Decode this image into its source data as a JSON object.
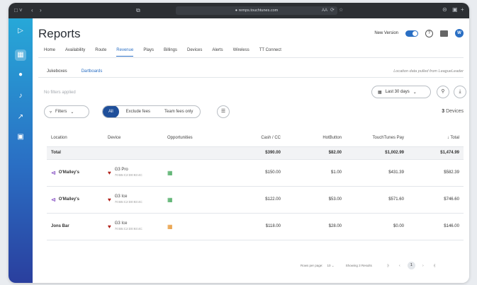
{
  "browser": {
    "url": "● remps.touchtunes.com",
    "tab_controls": "□ ˅",
    "nav_back": "‹",
    "nav_fwd": "›",
    "share": "⧉",
    "reader": "AA",
    "refresh": "⟳",
    "star": "☆"
  },
  "header": {
    "title": "Reports",
    "new_version_label": "New Version",
    "help": "?",
    "avatar": "W"
  },
  "tabs": [
    "Home",
    "Availability",
    "Route",
    "Revenue",
    "Plays",
    "Billings",
    "Devices",
    "Alerts",
    "Wireless",
    "TT Connect"
  ],
  "active_tab": "Revenue",
  "subtabs": [
    "Jukeboxes",
    "Dartboards"
  ],
  "active_subtab": "Dartboards",
  "location_note": "Location data pulled from LeagueLeader",
  "filters": {
    "no_filters": "No filters applied",
    "date_range": "Last 30 days",
    "filters_label": "Filters",
    "segments": [
      "All",
      "Exclude fees",
      "Team fees only"
    ],
    "active_segment": "All",
    "device_count": "3",
    "device_count_suffix": "Devices"
  },
  "table": {
    "columns": [
      "Location",
      "Device",
      "Opportunities",
      "Cash / CC",
      "HotButton",
      "TouchTunes Pay",
      "↓ Total"
    ],
    "total_row": {
      "label": "Total",
      "cash_cc": "$390.00",
      "hotbutton": "$82.00",
      "tt_pay": "$1,002.99",
      "total": "$1,474.99"
    },
    "rows": [
      {
        "location": "O'Malley's",
        "shared": true,
        "device": "G3 Pro",
        "mac": "70:B5:C2:D0:93:4C",
        "opp_color": "green",
        "cash_cc": "$150.00",
        "hotbutton": "$1.00",
        "tt_pay": "$431.39",
        "total": "$582.39"
      },
      {
        "location": "O'Malley's",
        "shared": true,
        "device": "G3 Ice",
        "mac": "70:B5:C2:D0:93:4C",
        "opp_color": "green",
        "cash_cc": "$122.00",
        "hotbutton": "$53.00",
        "tt_pay": "$571.60",
        "total": "$746.60"
      },
      {
        "location": "Jons Bar",
        "shared": false,
        "device": "G3 Ice",
        "mac": "70:B5:C2:D0:93:4C",
        "opp_color": "orange",
        "cash_cc": "$118.00",
        "hotbutton": "$28.00",
        "tt_pay": "$0.00",
        "total": "$146.00"
      }
    ]
  },
  "pagination": {
    "rows_per_page_label": "Rows per page:",
    "rows_per_page": "10",
    "showing": "Showing 3 Results",
    "current_page": "1"
  },
  "icons": {
    "sidebar": [
      "logo-icon",
      "reports-icon",
      "location-icon",
      "music-icon",
      "trend-icon",
      "cart-icon"
    ]
  }
}
